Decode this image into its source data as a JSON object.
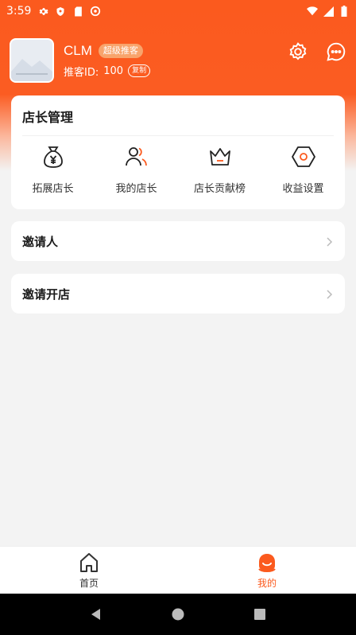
{
  "status_bar": {
    "time": "3:59"
  },
  "profile": {
    "name": "CLM",
    "badge": "超级推客",
    "id_label": "推客ID:",
    "id_value": "100",
    "copy_label": "复制"
  },
  "manage": {
    "title": "店长管理",
    "items": [
      {
        "label": "拓展店长",
        "icon": "money-bag-icon"
      },
      {
        "label": "我的店长",
        "icon": "users-icon"
      },
      {
        "label": "店长贡献榜",
        "icon": "crown-icon"
      },
      {
        "label": "收益设置",
        "icon": "hexagon-settings-icon"
      }
    ]
  },
  "rows": {
    "invite": "邀请人",
    "open_store": "邀请开店"
  },
  "tabbar": {
    "home": "首页",
    "mine": "我的"
  },
  "colors": {
    "accent": "#fb5a1e",
    "background": "#f3f3f3"
  }
}
